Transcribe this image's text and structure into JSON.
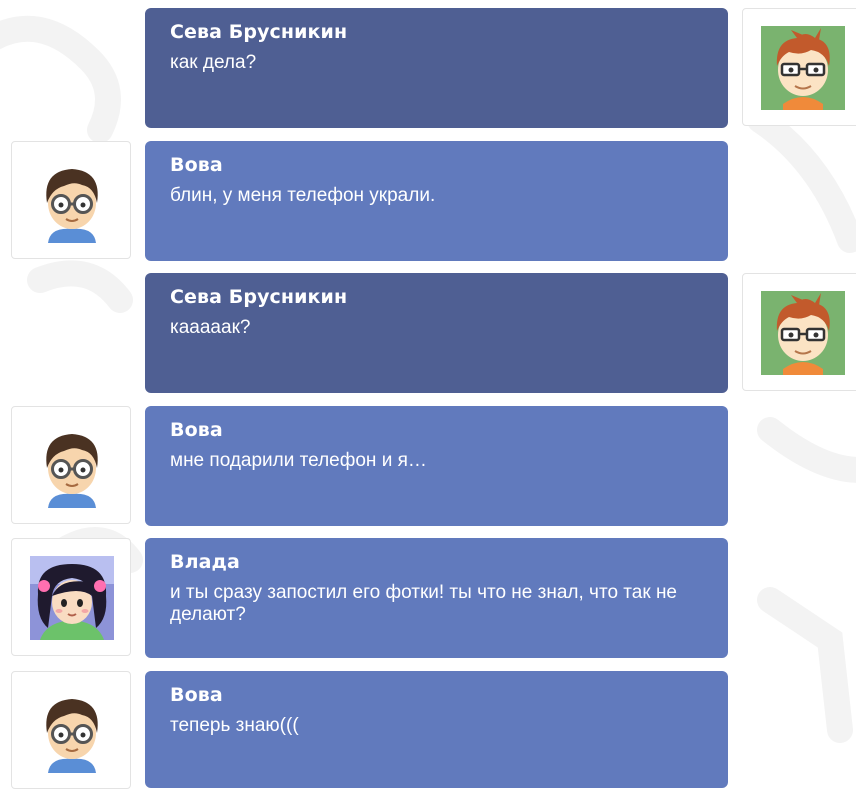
{
  "messages": [
    {
      "sender": "Сева Брусникин",
      "text": "как дела?",
      "side": "right",
      "avatar": "seva-avatar-icon"
    },
    {
      "sender": "Вова",
      "text": "блин, у меня телефон украли.",
      "side": "left",
      "avatar": "vova-avatar-icon"
    },
    {
      "sender": "Сева Брусникин",
      "text": "кааааак?",
      "side": "right",
      "avatar": "seva-avatar-icon"
    },
    {
      "sender": "Вова",
      "text": "мне подарили телефон и я…",
      "side": "left",
      "avatar": "vova-avatar-icon"
    },
    {
      "sender": "Влада",
      "text": "и ты сразу запостил его фотки! ты что не знал, что так не делают?",
      "side": "left",
      "avatar": "vlada-avatar-icon"
    },
    {
      "sender": "Вова",
      "text": "теперь знаю(((",
      "side": "left",
      "avatar": "vova-avatar-icon"
    }
  ],
  "colors": {
    "bubble_self": "#4f5f93",
    "bubble_other": "#617abd",
    "text": "#ffffff",
    "seva_avatar_bg": "#7ab36f",
    "vlada_avatar_bg": "#8d93d8"
  }
}
